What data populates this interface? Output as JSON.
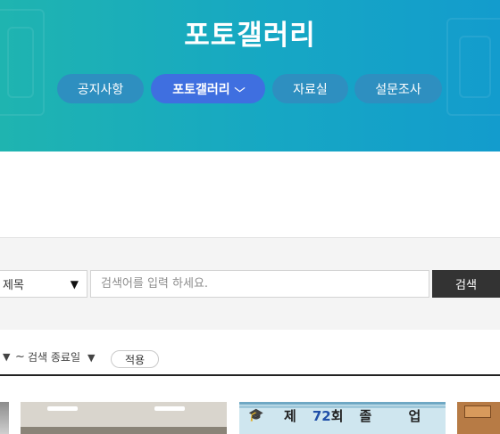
{
  "header": {
    "title": "포토갤러리",
    "tabs": [
      {
        "label": "공지사항",
        "active": false
      },
      {
        "label": "포토갤러리",
        "active": true,
        "icon": "chevron-down-icon"
      },
      {
        "label": "자료실",
        "active": false
      },
      {
        "label": "설문조사",
        "active": false
      }
    ]
  },
  "search": {
    "field_select": "제목",
    "input_placeholder": "검색어를 입력 하세요.",
    "input_value": "",
    "button_label": "검색"
  },
  "date_filter": {
    "separator": "~",
    "end_label": "검색 종료일",
    "apply_label": "적용"
  },
  "gallery": {
    "thumb_2_prefix": "제",
    "thumb_2_number": "72",
    "thumb_2_suffix": "회",
    "thumb_2_title": "졸 업 식"
  },
  "colors": {
    "banner_start": "#1fb4b0",
    "banner_end": "#139ccd",
    "tab": "#2e8fc0",
    "tab_active": "#3f6fe0",
    "search_button": "#333333"
  }
}
